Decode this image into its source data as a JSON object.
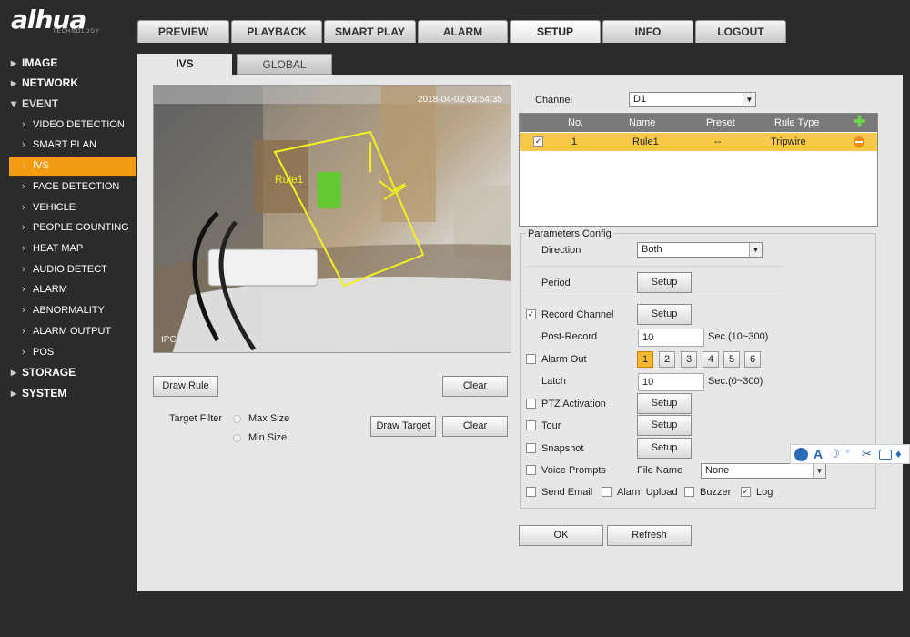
{
  "brand": {
    "logo": "alhua",
    "sub": "TECHNOLOGY"
  },
  "nav": {
    "tabs": [
      "PREVIEW",
      "PLAYBACK",
      "SMART PLAY",
      "ALARM",
      "SETUP",
      "INFO",
      "LOGOUT"
    ],
    "active": "SETUP"
  },
  "sidebar": {
    "image": "IMAGE",
    "network": "NETWORK",
    "event": "EVENT",
    "items": [
      "VIDEO DETECTION",
      "SMART PLAN",
      "IVS",
      "FACE DETECTION",
      "VEHICLE",
      "PEOPLE COUNTING",
      "HEAT MAP",
      "AUDIO DETECT",
      "ALARM",
      "ABNORMALITY",
      "ALARM OUTPUT",
      "POS"
    ],
    "storage": "STORAGE",
    "system": "SYSTEM"
  },
  "subtabs": {
    "ivs": "IVS",
    "global": "GLOBAL"
  },
  "video": {
    "timestamp": "2018-04-02 03:54:35",
    "cam_label": "IPC",
    "rule_label": "Rule1"
  },
  "left_controls": {
    "draw_rule": "Draw Rule",
    "clear1": "Clear",
    "target_filter": "Target Filter",
    "max_size": "Max Size",
    "min_size": "Min Size",
    "draw_target": "Draw Target",
    "clear2": "Clear"
  },
  "channel": {
    "label": "Channel",
    "value": "D1"
  },
  "rule_table": {
    "headers": {
      "no": "No.",
      "name": "Name",
      "preset": "Preset",
      "rule_type": "Rule Type"
    },
    "row": {
      "checked": "✓",
      "no": "1",
      "name": "Rule1",
      "preset": "--",
      "rule_type": "Tripwire"
    }
  },
  "params": {
    "title": "Parameters Config",
    "direction_label": "Direction",
    "direction_value": "Both",
    "period_label": "Period",
    "setup": "Setup",
    "record_channel": "Record Channel",
    "post_record_label": "Post-Record",
    "post_record_value": "10",
    "post_record_unit": "Sec.(10~300)",
    "alarm_out": "Alarm Out",
    "alarm_nums": [
      "1",
      "2",
      "3",
      "4",
      "5",
      "6"
    ],
    "latch_label": "Latch",
    "latch_value": "10",
    "latch_unit": "Sec.(0~300)",
    "ptz": "PTZ Activation",
    "tour": "Tour",
    "snapshot": "Snapshot",
    "voice": "Voice Prompts",
    "file_name_label": "File Name",
    "file_name_value": "None",
    "send_email": "Send Email",
    "alarm_upload": "Alarm Upload",
    "buzzer": "Buzzer",
    "log": "Log",
    "check": "✓"
  },
  "footer": {
    "ok": "OK",
    "refresh": "Refresh"
  },
  "ime_toolbar": {
    "glyph_a": "A"
  },
  "colors": {
    "accent": "#f39c12",
    "row_highlight": "#f7c948"
  }
}
